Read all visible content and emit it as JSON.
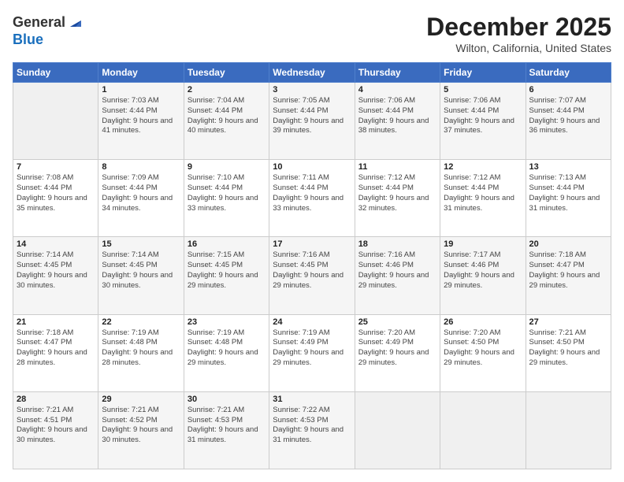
{
  "logo": {
    "general": "General",
    "blue": "Blue"
  },
  "title": "December 2025",
  "location": "Wilton, California, United States",
  "header": {
    "days": [
      "Sunday",
      "Monday",
      "Tuesday",
      "Wednesday",
      "Thursday",
      "Friday",
      "Saturday"
    ]
  },
  "weeks": [
    [
      {
        "day": "",
        "sunrise": "",
        "sunset": "",
        "daylight": ""
      },
      {
        "day": "1",
        "sunrise": "Sunrise: 7:03 AM",
        "sunset": "Sunset: 4:44 PM",
        "daylight": "Daylight: 9 hours and 41 minutes."
      },
      {
        "day": "2",
        "sunrise": "Sunrise: 7:04 AM",
        "sunset": "Sunset: 4:44 PM",
        "daylight": "Daylight: 9 hours and 40 minutes."
      },
      {
        "day": "3",
        "sunrise": "Sunrise: 7:05 AM",
        "sunset": "Sunset: 4:44 PM",
        "daylight": "Daylight: 9 hours and 39 minutes."
      },
      {
        "day": "4",
        "sunrise": "Sunrise: 7:06 AM",
        "sunset": "Sunset: 4:44 PM",
        "daylight": "Daylight: 9 hours and 38 minutes."
      },
      {
        "day": "5",
        "sunrise": "Sunrise: 7:06 AM",
        "sunset": "Sunset: 4:44 PM",
        "daylight": "Daylight: 9 hours and 37 minutes."
      },
      {
        "day": "6",
        "sunrise": "Sunrise: 7:07 AM",
        "sunset": "Sunset: 4:44 PM",
        "daylight": "Daylight: 9 hours and 36 minutes."
      }
    ],
    [
      {
        "day": "7",
        "sunrise": "Sunrise: 7:08 AM",
        "sunset": "Sunset: 4:44 PM",
        "daylight": "Daylight: 9 hours and 35 minutes."
      },
      {
        "day": "8",
        "sunrise": "Sunrise: 7:09 AM",
        "sunset": "Sunset: 4:44 PM",
        "daylight": "Daylight: 9 hours and 34 minutes."
      },
      {
        "day": "9",
        "sunrise": "Sunrise: 7:10 AM",
        "sunset": "Sunset: 4:44 PM",
        "daylight": "Daylight: 9 hours and 33 minutes."
      },
      {
        "day": "10",
        "sunrise": "Sunrise: 7:11 AM",
        "sunset": "Sunset: 4:44 PM",
        "daylight": "Daylight: 9 hours and 33 minutes."
      },
      {
        "day": "11",
        "sunrise": "Sunrise: 7:12 AM",
        "sunset": "Sunset: 4:44 PM",
        "daylight": "Daylight: 9 hours and 32 minutes."
      },
      {
        "day": "12",
        "sunrise": "Sunrise: 7:12 AM",
        "sunset": "Sunset: 4:44 PM",
        "daylight": "Daylight: 9 hours and 31 minutes."
      },
      {
        "day": "13",
        "sunrise": "Sunrise: 7:13 AM",
        "sunset": "Sunset: 4:44 PM",
        "daylight": "Daylight: 9 hours and 31 minutes."
      }
    ],
    [
      {
        "day": "14",
        "sunrise": "Sunrise: 7:14 AM",
        "sunset": "Sunset: 4:45 PM",
        "daylight": "Daylight: 9 hours and 30 minutes."
      },
      {
        "day": "15",
        "sunrise": "Sunrise: 7:14 AM",
        "sunset": "Sunset: 4:45 PM",
        "daylight": "Daylight: 9 hours and 30 minutes."
      },
      {
        "day": "16",
        "sunrise": "Sunrise: 7:15 AM",
        "sunset": "Sunset: 4:45 PM",
        "daylight": "Daylight: 9 hours and 29 minutes."
      },
      {
        "day": "17",
        "sunrise": "Sunrise: 7:16 AM",
        "sunset": "Sunset: 4:45 PM",
        "daylight": "Daylight: 9 hours and 29 minutes."
      },
      {
        "day": "18",
        "sunrise": "Sunrise: 7:16 AM",
        "sunset": "Sunset: 4:46 PM",
        "daylight": "Daylight: 9 hours and 29 minutes."
      },
      {
        "day": "19",
        "sunrise": "Sunrise: 7:17 AM",
        "sunset": "Sunset: 4:46 PM",
        "daylight": "Daylight: 9 hours and 29 minutes."
      },
      {
        "day": "20",
        "sunrise": "Sunrise: 7:18 AM",
        "sunset": "Sunset: 4:47 PM",
        "daylight": "Daylight: 9 hours and 29 minutes."
      }
    ],
    [
      {
        "day": "21",
        "sunrise": "Sunrise: 7:18 AM",
        "sunset": "Sunset: 4:47 PM",
        "daylight": "Daylight: 9 hours and 28 minutes."
      },
      {
        "day": "22",
        "sunrise": "Sunrise: 7:19 AM",
        "sunset": "Sunset: 4:48 PM",
        "daylight": "Daylight: 9 hours and 28 minutes."
      },
      {
        "day": "23",
        "sunrise": "Sunrise: 7:19 AM",
        "sunset": "Sunset: 4:48 PM",
        "daylight": "Daylight: 9 hours and 29 minutes."
      },
      {
        "day": "24",
        "sunrise": "Sunrise: 7:19 AM",
        "sunset": "Sunset: 4:49 PM",
        "daylight": "Daylight: 9 hours and 29 minutes."
      },
      {
        "day": "25",
        "sunrise": "Sunrise: 7:20 AM",
        "sunset": "Sunset: 4:49 PM",
        "daylight": "Daylight: 9 hours and 29 minutes."
      },
      {
        "day": "26",
        "sunrise": "Sunrise: 7:20 AM",
        "sunset": "Sunset: 4:50 PM",
        "daylight": "Daylight: 9 hours and 29 minutes."
      },
      {
        "day": "27",
        "sunrise": "Sunrise: 7:21 AM",
        "sunset": "Sunset: 4:50 PM",
        "daylight": "Daylight: 9 hours and 29 minutes."
      }
    ],
    [
      {
        "day": "28",
        "sunrise": "Sunrise: 7:21 AM",
        "sunset": "Sunset: 4:51 PM",
        "daylight": "Daylight: 9 hours and 30 minutes."
      },
      {
        "day": "29",
        "sunrise": "Sunrise: 7:21 AM",
        "sunset": "Sunset: 4:52 PM",
        "daylight": "Daylight: 9 hours and 30 minutes."
      },
      {
        "day": "30",
        "sunrise": "Sunrise: 7:21 AM",
        "sunset": "Sunset: 4:53 PM",
        "daylight": "Daylight: 9 hours and 31 minutes."
      },
      {
        "day": "31",
        "sunrise": "Sunrise: 7:22 AM",
        "sunset": "Sunset: 4:53 PM",
        "daylight": "Daylight: 9 hours and 31 minutes."
      },
      {
        "day": "",
        "sunrise": "",
        "sunset": "",
        "daylight": ""
      },
      {
        "day": "",
        "sunrise": "",
        "sunset": "",
        "daylight": ""
      },
      {
        "day": "",
        "sunrise": "",
        "sunset": "",
        "daylight": ""
      }
    ]
  ]
}
